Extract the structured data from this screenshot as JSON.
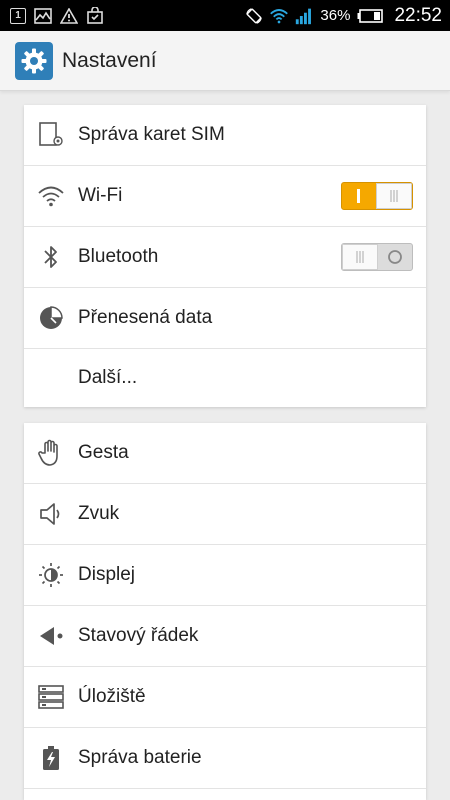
{
  "statusbar": {
    "notification_count": "1",
    "battery_percent": "36%",
    "time": "22:52"
  },
  "appbar": {
    "title": "Nastavení"
  },
  "sections": {
    "connectivity": [
      {
        "label": "Správa karet SIM",
        "icon": "sim-settings-icon"
      },
      {
        "label": "Wi-Fi",
        "icon": "wifi-icon",
        "toggle": "on"
      },
      {
        "label": "Bluetooth",
        "icon": "bluetooth-icon",
        "toggle": "off"
      },
      {
        "label": "Přenesená data",
        "icon": "data-usage-icon"
      },
      {
        "label": "Další..."
      }
    ],
    "device": [
      {
        "label": "Gesta",
        "icon": "hand-gesture-icon"
      },
      {
        "label": "Zvuk",
        "icon": "speaker-icon"
      },
      {
        "label": "Displej",
        "icon": "brightness-icon"
      },
      {
        "label": "Stavový řádek",
        "icon": "status-bar-icon"
      },
      {
        "label": "Úložiště",
        "icon": "storage-icon"
      },
      {
        "label": "Správa baterie",
        "icon": "battery-manager-icon"
      }
    ]
  },
  "colors": {
    "toggle_on": "#f5a800",
    "app_icon": "#2f7fb8"
  }
}
